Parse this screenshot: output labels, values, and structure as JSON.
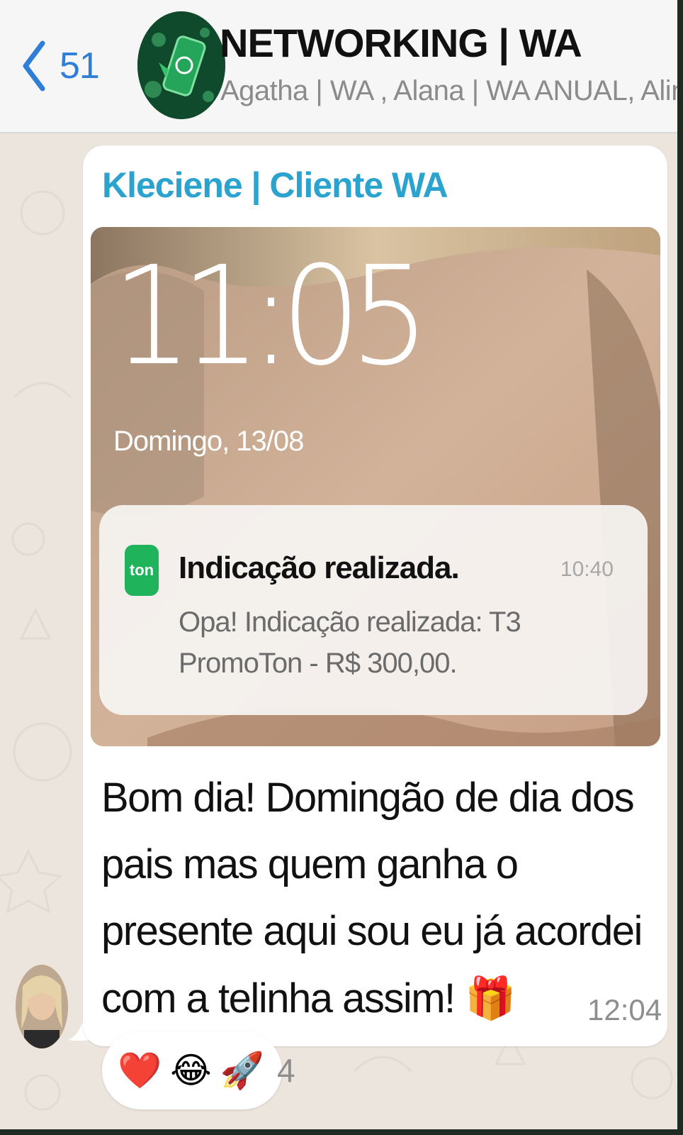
{
  "header": {
    "back_count": "51",
    "title": "NETWORKING | WA",
    "subtitle": "Agatha | WA , Alana | WA ANUAL, Aline..."
  },
  "message": {
    "sender": "Kleciene | Cliente WA",
    "image": {
      "lock_time": "11:05",
      "lock_date": "Domingo, 13/08",
      "notification": {
        "app_icon_label": "ton",
        "title": "Indicação realizada.",
        "time": "10:40",
        "body": "Opa! Indicação realizada: T3 PromoTon - R$ 300,00."
      }
    },
    "text": "Bom dia! Domingão de dia dos pais mas quem ganha o presente aqui sou eu já acordei com a telinha assim!",
    "emoji_inline": "🎁",
    "emoji_line": "🤑 💰",
    "time": "12:04"
  },
  "reactions": {
    "items": [
      "❤️",
      "😂",
      "🚀"
    ],
    "count": "4"
  },
  "colors": {
    "sender_name": "#2aa3cf",
    "back_link": "#2f7ed8",
    "chat_background": "#ece5dd",
    "app_icon": "#1fb45c"
  }
}
